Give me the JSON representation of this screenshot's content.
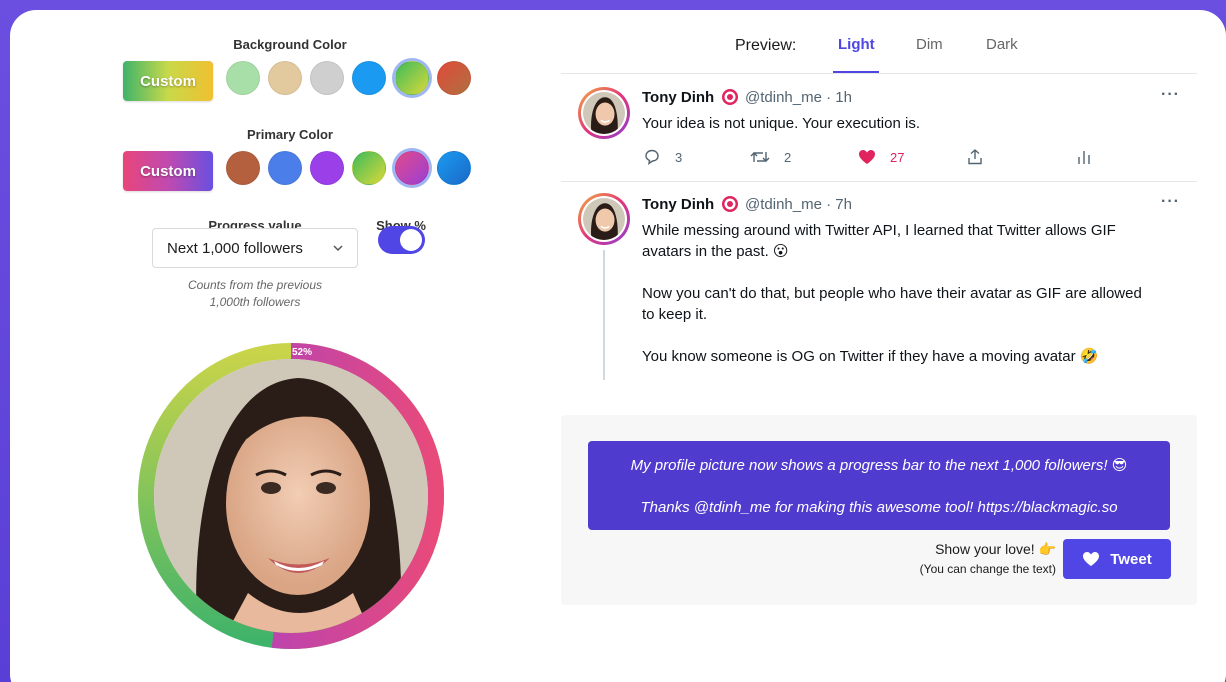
{
  "background_color": {
    "label": "Background Color",
    "custom_label": "Custom",
    "swatches": [
      "#a8dfa8",
      "#e3c99e",
      "#cfcfcf",
      "#1a9af0",
      "gradient-green-yellow",
      "gradient-red-brown"
    ],
    "selected_index": 4
  },
  "primary_color": {
    "label": "Primary Color",
    "custom_label": "Custom",
    "swatches": [
      "#b4603f",
      "#4b7ee8",
      "#9b3fe8",
      "gradient-green-yellow",
      "gradient-pink-purple",
      "gradient-blue"
    ],
    "selected_index": 4
  },
  "progress": {
    "label": "Progress value",
    "selected": "Next 1,000 followers",
    "hint_line1": "Counts from the previous",
    "hint_line2": "1,000th followers",
    "show_pct_label": "Show %",
    "show_pct_enabled": true,
    "percent_label": "52%",
    "percent_value": 52
  },
  "preview": {
    "label": "Preview:",
    "tabs": [
      "Light",
      "Dim",
      "Dark"
    ],
    "active_tab": "Light"
  },
  "tweets": [
    {
      "name": "Tony Dinh",
      "handle": "@tdinh_me · 1h",
      "text": "Your idea is not unique. Your execution is.",
      "replies": "3",
      "retweets": "2",
      "likes": "27"
    },
    {
      "name": "Tony Dinh",
      "handle": "@tdinh_me · 7h",
      "para1_line1": "While messing around with Twitter API, I learned that Twitter allows GIF",
      "para1_line2": "avatars in the past. 😮",
      "para2_line1": "Now you can't do that, but people who have their avatar as GIF are allowed",
      "para2_line2": "to keep it.",
      "para3": "You know someone is OG on Twitter if they have a moving avatar 🤣"
    }
  ],
  "share": {
    "message_line1": "My profile picture now shows a progress bar to the next 1,000 followers! 😎",
    "message_line2": "Thanks @tdinh_me for making this awesome tool! https://blackmagic.so",
    "love_text": "Show your love! 👉",
    "love_sub": "(You can change the text)",
    "tweet_button": "Tweet"
  },
  "colors": {
    "accent": "#4f46e5",
    "like": "#e0245e",
    "message_bg": "#4f3ccf"
  }
}
